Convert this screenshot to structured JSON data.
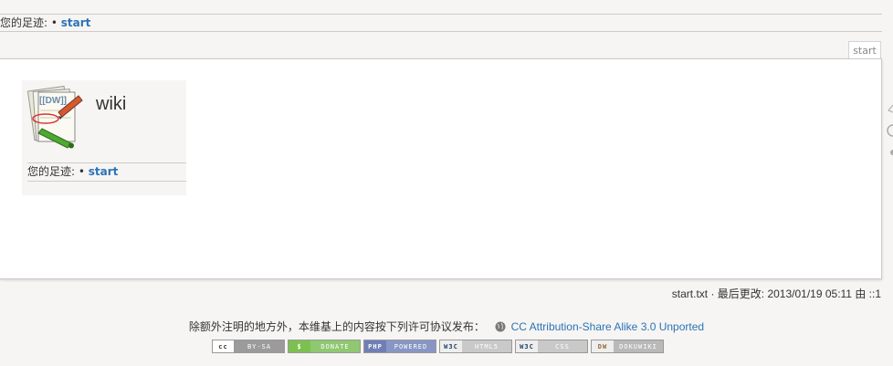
{
  "breadcrumbs": {
    "label": "您的足迹:",
    "separator": "•",
    "items": [
      "start"
    ]
  },
  "page_tab": "start",
  "embedded": {
    "title": "wiki",
    "logo_text": "[[DW]]",
    "breadcrumbs": {
      "label": "您的足迹:",
      "separator": "•",
      "items": [
        "start"
      ]
    }
  },
  "doc_info": "start.txt · 最后更改: 2013/01/19 05:11 由 ::1",
  "license": {
    "text": "除额外注明的地方外，本维基上的内容按下列许可协议发布：",
    "link": "CC Attribution-Share Alike 3.0 Unported"
  },
  "badges": [
    {
      "badge": "cc",
      "label": "BY-SA"
    },
    {
      "badge": "$",
      "label": "DONATE"
    },
    {
      "badge": "PHP",
      "label": "POWERED"
    },
    {
      "badge": "W3C",
      "label": "HTML5"
    },
    {
      "badge": "W3C",
      "label": "CSS"
    },
    {
      "badge": "DW",
      "label": "DOKUWIKI"
    }
  ],
  "colors": {
    "link": "#2b73b7",
    "background": "#f6f5f3",
    "page": "#ffffff"
  }
}
